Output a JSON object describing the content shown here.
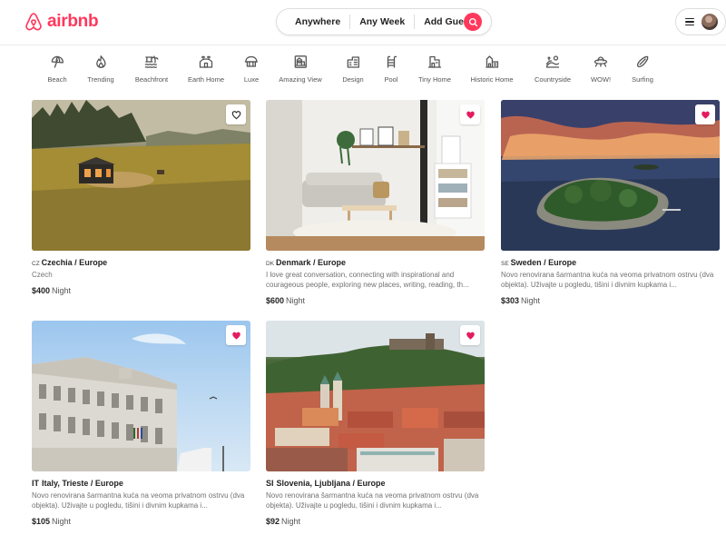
{
  "brand": {
    "name": "airbnb",
    "color": "#ff385c",
    "logo_icon": "airbnb-belo-logo"
  },
  "search": {
    "location": "Anywhere",
    "week": "Any Week",
    "guests": "Add Guests",
    "button_icon": "search-icon"
  },
  "user_menu": {
    "menu_icon": "hamburger-icon",
    "avatar": "user-avatar"
  },
  "categories": [
    {
      "label": "Beach",
      "icon": "umbrella-icon"
    },
    {
      "label": "Trending",
      "icon": "flame-icon"
    },
    {
      "label": "Beachfront",
      "icon": "beachfront-icon"
    },
    {
      "label": "Earth Home",
      "icon": "earth-home-icon"
    },
    {
      "label": "Luxe",
      "icon": "diamond-icon"
    },
    {
      "label": "Amazing View",
      "icon": "view-icon"
    },
    {
      "label": "Design",
      "icon": "design-icon"
    },
    {
      "label": "Pool",
      "icon": "pool-icon"
    },
    {
      "label": "Tiny Home",
      "icon": "tiny-home-icon"
    },
    {
      "label": "Historic Home",
      "icon": "historic-home-icon"
    },
    {
      "label": "Countryside",
      "icon": "countryside-icon"
    },
    {
      "label": "WOW!",
      "icon": "ufo-icon"
    },
    {
      "label": "Surfing",
      "icon": "surfboard-icon"
    }
  ],
  "listings": [
    {
      "country_code": "CZ",
      "title": "Czechia / Europe",
      "description": "Czech",
      "price": "$400",
      "per": "Night",
      "favorited": false,
      "image": "tiny-cabin-meadow"
    },
    {
      "country_code": "DK",
      "title": "Denmark / Europe",
      "description": "I love great conversation, connecting with inspirational and courageous people, exploring new places, writing, reading, th...",
      "price": "$600",
      "per": "Night",
      "favorited": true,
      "image": "scandinavian-living-room"
    },
    {
      "country_code": "SE",
      "title": "Sweden / Europe",
      "description": "Novo renovirana šarmantna kuća na veoma privatnom ostrvu (dva objekta). Uživajte u pogledu, tišini i divnim kupkama i...",
      "price": "$303",
      "per": "Night",
      "favorited": true,
      "image": "island-sunset-aerial"
    },
    {
      "country_code": "IT",
      "title": "Italy, Trieste / Europe",
      "description": "Novo renovirana šarmantna kuća na veoma privatnom ostrvu (dva objekta). Uživajte u pogledu, tišini i divnim kupkama i...",
      "price": "$105",
      "per": "Night",
      "favorited": true,
      "image": "trieste-palace"
    },
    {
      "country_code": "SI",
      "title": "Slovenia, Ljubljana / Europe",
      "description": "Novo renovirana šarmantna kuća na veoma privatnom ostrvu (dva objekta). Uživajte u pogledu, tišini i divnim kupkama i...",
      "price": "$92",
      "per": "Night",
      "favorited": true,
      "image": "ljubljana-old-town"
    }
  ]
}
